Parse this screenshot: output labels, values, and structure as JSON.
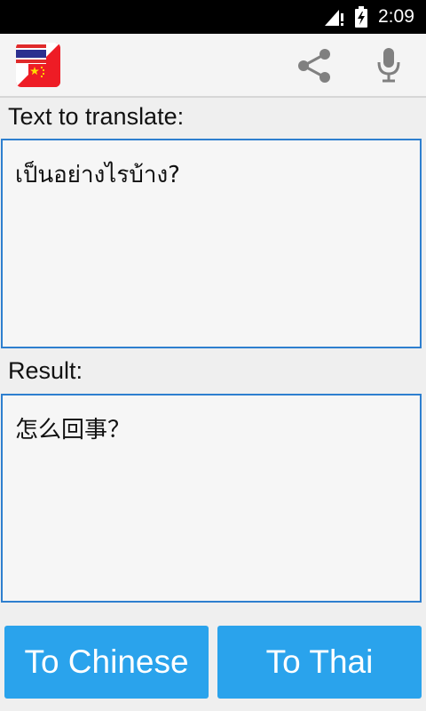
{
  "status_bar": {
    "time": "2:09",
    "icons": [
      "signal-icon",
      "battery-charging-icon"
    ]
  },
  "action_bar": {
    "app_icon": "thai-chinese-flag-icon",
    "actions": [
      "share-icon",
      "microphone-icon"
    ]
  },
  "input_section": {
    "label": "Text to translate:",
    "value": "เป็นอย่างไรบ้าง?"
  },
  "result_section": {
    "label": "Result:",
    "value": "怎么回事？"
  },
  "buttons": {
    "to_chinese": "To Chinese",
    "to_thai": "To Thai"
  },
  "colors": {
    "accent": "#2aa3ec",
    "box_border": "#2e7fcf",
    "status_bar": "#000000",
    "action_bar": "#f4f4f4",
    "background": "#efefef"
  }
}
